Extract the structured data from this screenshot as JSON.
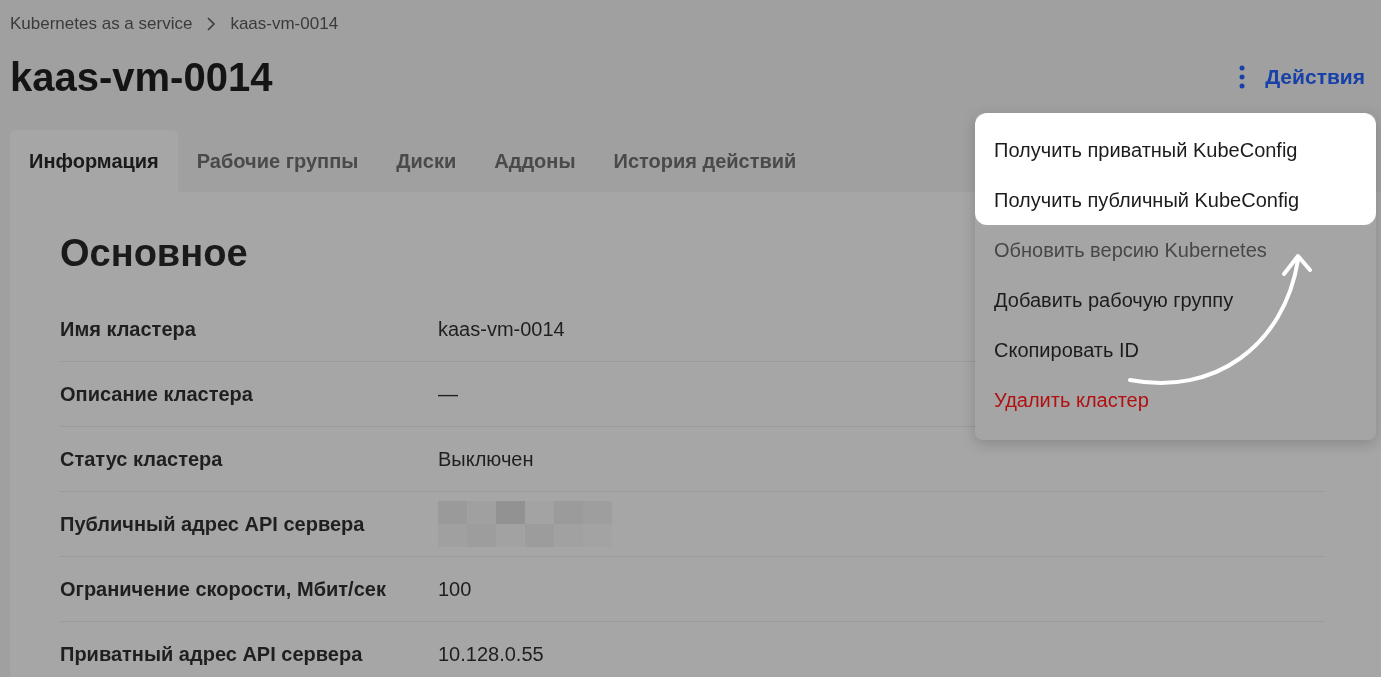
{
  "breadcrumbs": [
    {
      "label": "Kubernetes as a service"
    },
    {
      "label": "kaas-vm-0014"
    }
  ],
  "title": "kaas-vm-0014",
  "actions": {
    "label": "Действия"
  },
  "tabs": [
    {
      "label": "Информация",
      "selected": true
    },
    {
      "label": "Рабочие группы",
      "selected": false
    },
    {
      "label": "Диски",
      "selected": false
    },
    {
      "label": "Аддоны",
      "selected": false
    },
    {
      "label": "История действий",
      "selected": false
    }
  ],
  "section": {
    "title": "Основное",
    "rows": [
      {
        "label": "Имя кластера",
        "value": "kaas-vm-0014"
      },
      {
        "label": "Описание кластера",
        "value": "—"
      },
      {
        "label": "Статус кластера",
        "value": "Выключен"
      },
      {
        "label": "Публичный адрес API сервера",
        "redacted": true
      },
      {
        "label": "Ограничение скорости, Мбит/сек",
        "value": "100"
      },
      {
        "label": "Приватный адрес API сервера",
        "value": "10.128.0.55"
      }
    ]
  },
  "menu": {
    "items": [
      {
        "label": "Получить приватный KubeConfig",
        "kind": "normal",
        "highlighted": true
      },
      {
        "label": "Получить публичный KubeConfig",
        "kind": "normal",
        "highlighted": true
      },
      {
        "label": "Обновить версию Kubernetes",
        "kind": "muted",
        "highlighted": false
      },
      {
        "label": "Добавить рабочую группу",
        "kind": "normal",
        "highlighted": false
      },
      {
        "label": "Скопировать ID",
        "kind": "normal",
        "highlighted": false
      },
      {
        "label": "Удалить кластер",
        "kind": "danger",
        "highlighted": false
      }
    ]
  }
}
